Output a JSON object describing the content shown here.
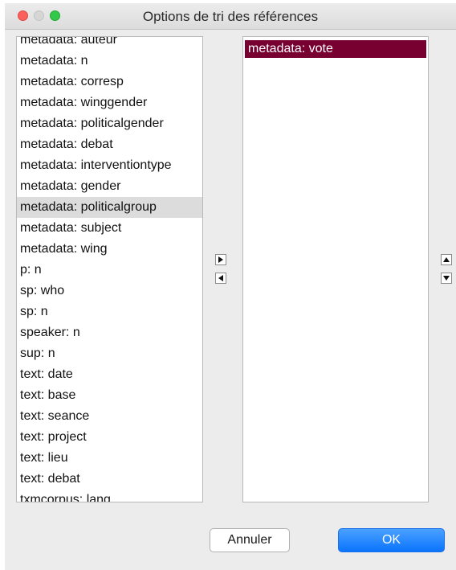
{
  "window": {
    "title": "Options de tri des références"
  },
  "left_list": {
    "items": [
      {
        "label": "metadata: auteur"
      },
      {
        "label": "metadata: n"
      },
      {
        "label": "metadata: corresp"
      },
      {
        "label": "metadata: winggender"
      },
      {
        "label": "metadata: politicalgender"
      },
      {
        "label": "metadata: debat"
      },
      {
        "label": "metadata: interventiontype"
      },
      {
        "label": "metadata: gender"
      },
      {
        "label": "metadata: politicalgroup",
        "selected": true
      },
      {
        "label": "metadata: subject"
      },
      {
        "label": "metadata: wing"
      },
      {
        "label": "p: n"
      },
      {
        "label": "sp: who"
      },
      {
        "label": "sp: n"
      },
      {
        "label": "speaker: n"
      },
      {
        "label": "sup: n"
      },
      {
        "label": "text: date"
      },
      {
        "label": "text: base"
      },
      {
        "label": "text: seance"
      },
      {
        "label": "text: project"
      },
      {
        "label": "text: lieu"
      },
      {
        "label": "text: debat"
      },
      {
        "label": "txmcorpus: lang"
      }
    ]
  },
  "right_list": {
    "items": [
      {
        "label": "metadata: vote",
        "selected": true
      }
    ],
    "selected_color": "#780030"
  },
  "transfer_buttons": {
    "add_icon": "triangle-right-icon",
    "remove_icon": "triangle-left-icon"
  },
  "order_buttons": {
    "up_icon": "triangle-up-icon",
    "down_icon": "triangle-down-icon"
  },
  "buttons": {
    "cancel_label": "Annuler",
    "ok_label": "OK"
  },
  "colors": {
    "ok_button": "#0a74ff",
    "close_light": "#fc605c",
    "max_light": "#34c84a"
  }
}
